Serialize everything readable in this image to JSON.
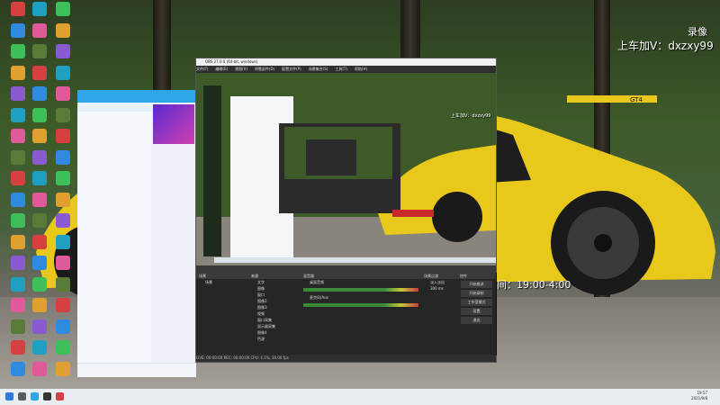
{
  "overlay": {
    "record_label": "录像",
    "contact_line": "上车加V：dxzxy99",
    "schedule_line": "新时间：19:00-4:00"
  },
  "colors": {
    "car_yellow": "#e8c81a",
    "chat_header": "#2fa6e8",
    "obs_bg": "#2b2b2b",
    "taskbar": "#e9eef3"
  },
  "desktop_icons": [
    {
      "label": "",
      "icon": "app-icon"
    },
    {
      "label": "",
      "icon": "app-icon"
    },
    {
      "label": "",
      "icon": "app-icon"
    },
    {
      "label": "",
      "icon": "app-icon"
    },
    {
      "label": "",
      "icon": "app-icon"
    },
    {
      "label": "",
      "icon": "app-icon"
    },
    {
      "label": "",
      "icon": "app-icon"
    },
    {
      "label": "",
      "icon": "app-icon"
    },
    {
      "label": "",
      "icon": "app-icon"
    },
    {
      "label": "Microsoft Edge",
      "icon": "edge-icon"
    },
    {
      "label": "",
      "icon": "app-icon"
    },
    {
      "label": "",
      "icon": "app-icon"
    }
  ],
  "chat_window": {
    "title": "",
    "rows": [
      "",
      "",
      "",
      "",
      "",
      "",
      "",
      "",
      "",
      "",
      "",
      "",
      "",
      "",
      "",
      "",
      "",
      "",
      "",
      "",
      "",
      "",
      "",
      "",
      "",
      "",
      "",
      "",
      "",
      ""
    ],
    "footer": ""
  },
  "obs": {
    "title": "OBS 27.0.0 (64-bit, windows)",
    "menu": [
      "文件(F)",
      "编辑(E)",
      "视图(V)",
      "停靠部件(D)",
      "配置文件(P)",
      "场景集合(S)",
      "工具(T)",
      "帮助(H)"
    ],
    "preview_overlay_line": "上车加V：dxzxy99",
    "docks": [
      {
        "title": "场景",
        "items": [
          "场景"
        ]
      },
      {
        "title": "来源",
        "items": [
          "文字",
          "图像",
          "窗口",
          "图像2",
          "图像3",
          "视频",
          "窗口采集",
          "显示器采集",
          "图像4",
          "色源"
        ]
      },
      {
        "title": "混音器",
        "items": [
          "桌面音频",
          "麦克风/Aux"
        ]
      },
      {
        "title": "场景过渡",
        "items": [
          "淡入淡出",
          "300 ms"
        ]
      },
      {
        "title": "控件",
        "items": [
          "开始推流",
          "开始录制",
          "工作室模式",
          "设置",
          "退出"
        ]
      }
    ],
    "status": "LIVE: 00:00:00   REC: 00:00:00   CPU: 4.1%, 30.00 fps"
  },
  "taskbar": {
    "time": "19:57",
    "date": "2021/9/8"
  }
}
